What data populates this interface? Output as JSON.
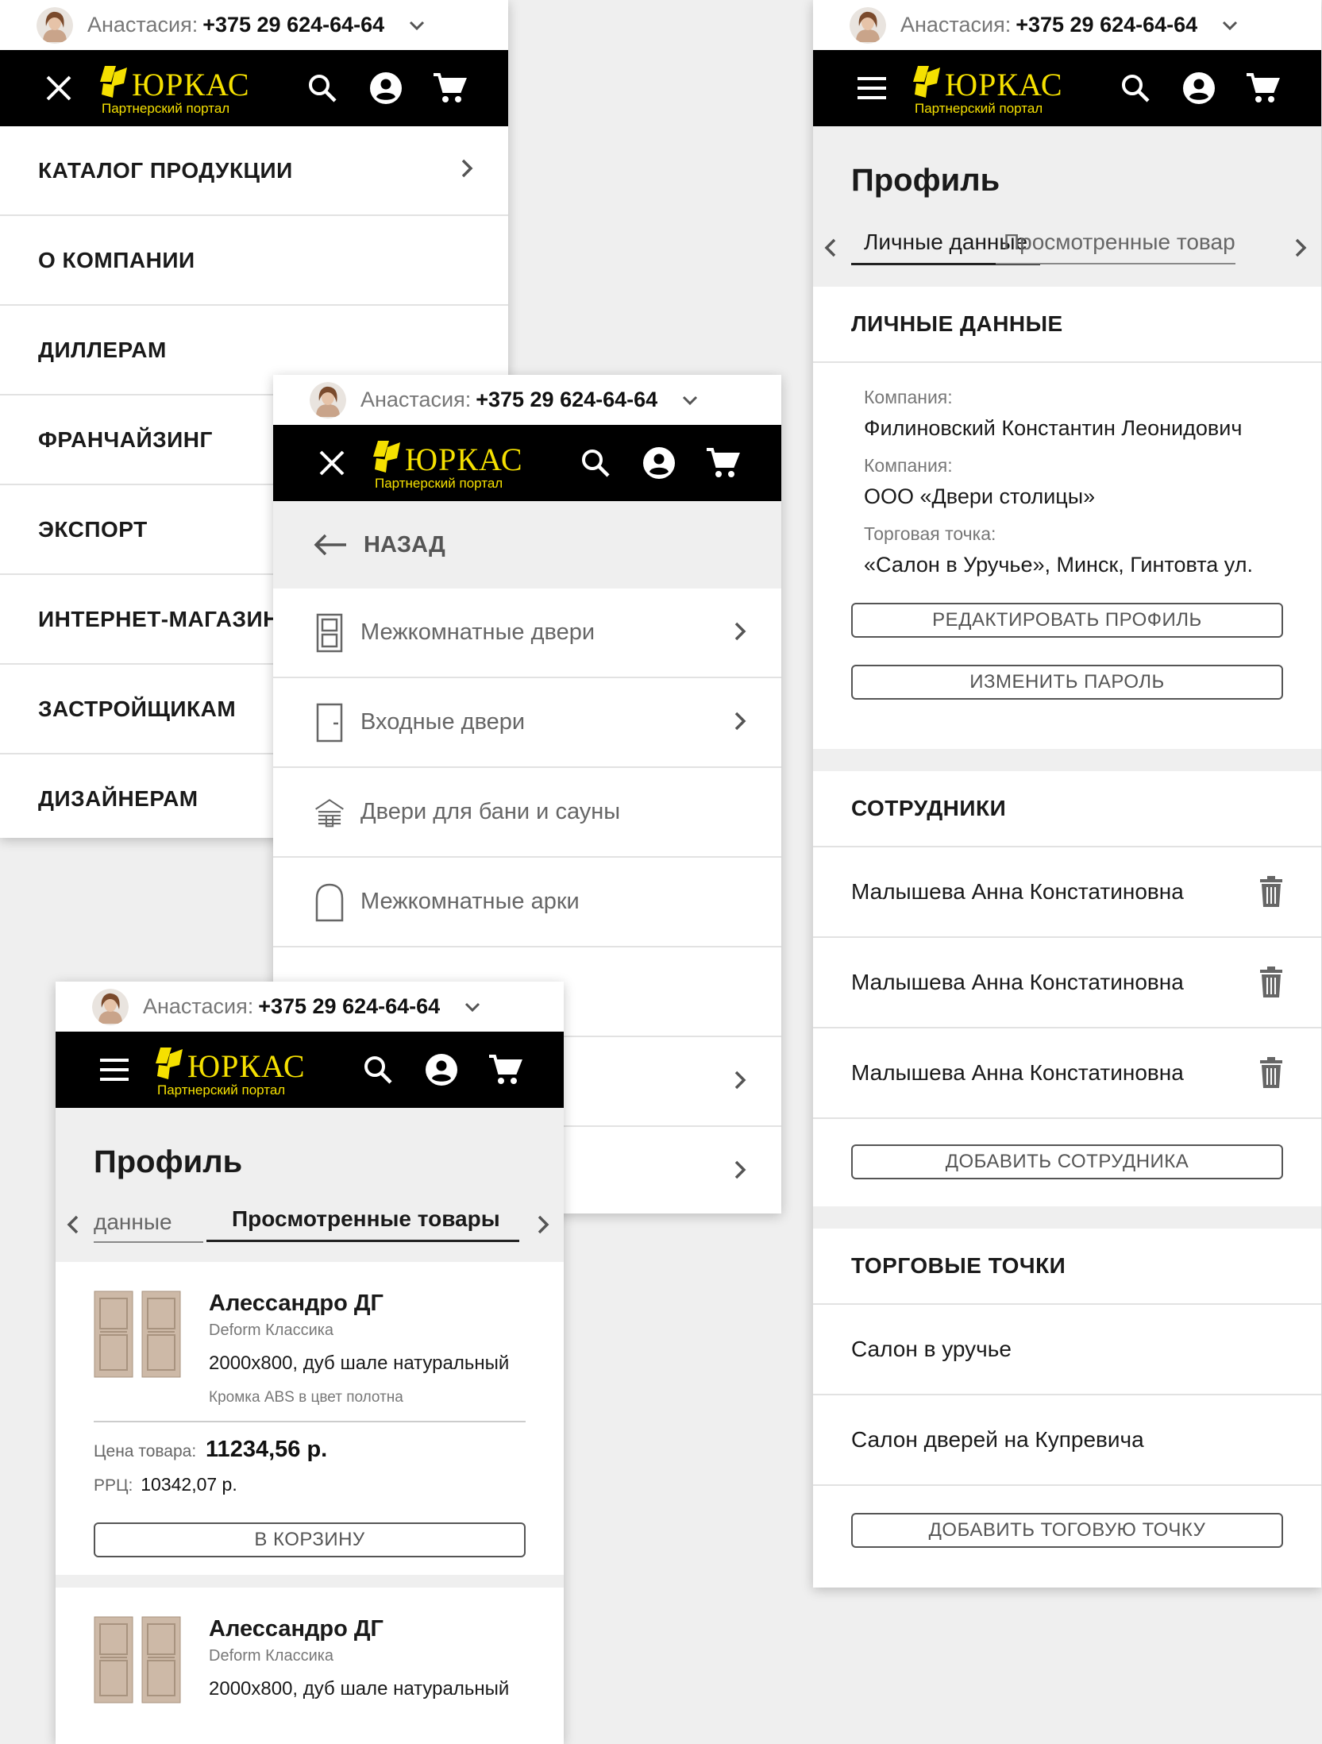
{
  "topbar": {
    "name": "Анастасия:",
    "phone": "+375 29 624-64-64"
  },
  "logo": {
    "brand": "ЮРКАС",
    "subtitle": "Партнерский портал"
  },
  "main_menu": [
    "КАТАЛОГ ПРОДУКЦИИ",
    "О КОМПАНИИ",
    "ДИЛЛЕРАМ",
    "ФРАНЧАЙЗИНГ",
    "ЭКСПОРТ",
    "ИНТЕРНЕТ-МАГАЗИН",
    "ЗАСТРОЙЩИКАМ",
    "ДИЗАЙНЕРАМ"
  ],
  "catalog": {
    "back_label": "НАЗАД",
    "items": [
      {
        "label": "Межкомнатные двери",
        "icon": "interior-door-icon"
      },
      {
        "label": "Входные двери",
        "icon": "entrance-door-icon"
      },
      {
        "label": "Двери для бани и сауны",
        "icon": "sauna-icon"
      },
      {
        "label": "Межкомнатные арки",
        "icon": "arch-icon"
      }
    ]
  },
  "profile": {
    "title": "Профиль",
    "tabs": [
      "Личные данные",
      "Просмотренные товары"
    ],
    "tab_personal_cut": "Просмотренные товар",
    "tab_viewed_cut": "данные",
    "personal": {
      "title": "ЛИЧНЫЕ ДАННЫЕ",
      "fields": [
        {
          "label": "Компания:",
          "value": "Филиновский Константин Леонидович"
        },
        {
          "label": "Компания:",
          "value": "ООО «Двери столицы»"
        },
        {
          "label": "Торговая точка:",
          "value": "«Салон в Уручье», Минск, Гинтовта ул."
        }
      ],
      "edit_btn": "РЕДАКТИРОВАТЬ ПРОФИЛЬ",
      "password_btn": "ИЗМЕНИТЬ ПАРОЛЬ"
    },
    "employees": {
      "title": "СОТРУДНИКИ",
      "items": [
        "Малышева Анна Констатиновна",
        "Малышева Анна Констатиновна",
        "Малышева Анна Констатиновна"
      ],
      "add_btn": "ДОБАВИТЬ СОТРУДНИКА"
    },
    "shops": {
      "title": "ТОРГОВЫЕ ТОЧКИ",
      "items": [
        "Салон в уручье",
        "Салон дверей на Купревича"
      ],
      "add_btn": "ДОБАВИТЬ ТОГОВУЮ ТОЧКУ"
    }
  },
  "products": [
    {
      "name": "Алессандро ДГ",
      "series": "Deform Классика",
      "desc": "2000х800, дуб шале натуральный",
      "note": "Кромка ABS в цвет полотна",
      "price_label": "Цена товара:",
      "price": "11234,56 р.",
      "rrp_label": "РРЦ:",
      "rrp": "10342,07 р.",
      "cart_btn": "В КОРЗИНУ"
    },
    {
      "name": "Алессандро ДГ",
      "series": "Deform Классика",
      "desc": "2000х800, дуб шале натуральный"
    }
  ],
  "colors": {
    "header_bg": "#000000",
    "logo_yellow": "#f5e000",
    "page_bg": "#efefef"
  }
}
